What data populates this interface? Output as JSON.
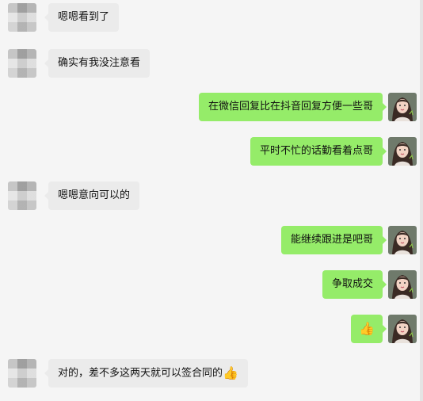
{
  "messages": [
    {
      "side": "left",
      "text": "嗯嗯看到了"
    },
    {
      "side": "left",
      "text": "确实有我没注意看"
    },
    {
      "side": "right",
      "text": "在微信回复比在抖音回复方便一些哥"
    },
    {
      "side": "right",
      "text": "平时不忙的话勤看着点哥"
    },
    {
      "side": "left",
      "text": "嗯嗯意向可以的"
    },
    {
      "side": "right",
      "text": "能继续跟进是吧哥"
    },
    {
      "side": "right",
      "text": "争取成交"
    },
    {
      "side": "right",
      "text": "",
      "emoji": "👍"
    },
    {
      "side": "left",
      "text": "对的，差不多这两天就可以签合同的",
      "emoji": "👍"
    }
  ],
  "colors": {
    "background": "#f5f5f5",
    "incoming_bubble": "#ebebeb",
    "outgoing_bubble": "#95ec69"
  },
  "icons": {
    "incoming_avatar": "blurred-avatar-icon",
    "outgoing_avatar": "portrait-avatar-icon",
    "emoji": "thumbs-up-icon"
  }
}
